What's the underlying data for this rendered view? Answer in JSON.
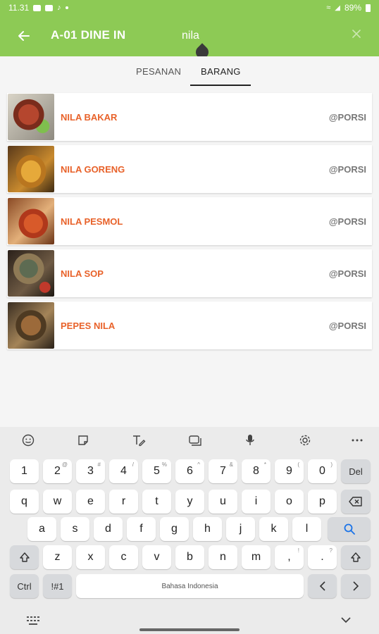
{
  "status_bar": {
    "time": "11.31",
    "battery": "89%"
  },
  "app_bar": {
    "title": "A-01 DINE IN",
    "search_value": "nila"
  },
  "tabs": [
    {
      "label": "PESANAN",
      "active": false
    },
    {
      "label": "BARANG",
      "active": true
    }
  ],
  "items": [
    {
      "name": "NILA BAKAR",
      "unit": "@PORSI"
    },
    {
      "name": "NILA GORENG",
      "unit": "@PORSI"
    },
    {
      "name": "NILA PESMOL",
      "unit": "@PORSI"
    },
    {
      "name": "NILA SOP",
      "unit": "@PORSI"
    },
    {
      "name": "PEPES NILA",
      "unit": "@PORSI"
    }
  ],
  "keyboard": {
    "row1": [
      {
        "label": "1",
        "sub": ""
      },
      {
        "label": "2",
        "sub": "@"
      },
      {
        "label": "3",
        "sub": "#"
      },
      {
        "label": "4",
        "sub": "/"
      },
      {
        "label": "5",
        "sub": "%"
      },
      {
        "label": "6",
        "sub": "^"
      },
      {
        "label": "7",
        "sub": "&"
      },
      {
        "label": "8",
        "sub": "*"
      },
      {
        "label": "9",
        "sub": "("
      },
      {
        "label": "0",
        "sub": ")"
      }
    ],
    "row2": [
      "q",
      "w",
      "e",
      "r",
      "t",
      "y",
      "u",
      "i",
      "o",
      "p"
    ],
    "row3": [
      "a",
      "s",
      "d",
      "f",
      "g",
      "h",
      "j",
      "k",
      "l"
    ],
    "row4": [
      "z",
      "x",
      "c",
      "v",
      "b",
      "n",
      "m"
    ],
    "row4_extra": [
      {
        "label": ",",
        "sub": "!"
      },
      {
        "label": ".",
        "sub": "?"
      }
    ],
    "del_label": "Del",
    "ctrl_label": "Ctrl",
    "symbols_label": "!#1",
    "space_label": "Bahasa Indonesia"
  },
  "colors": {
    "accent": "#8dca55",
    "item_name": "#e8622a",
    "search_key": "#1a73e8"
  }
}
